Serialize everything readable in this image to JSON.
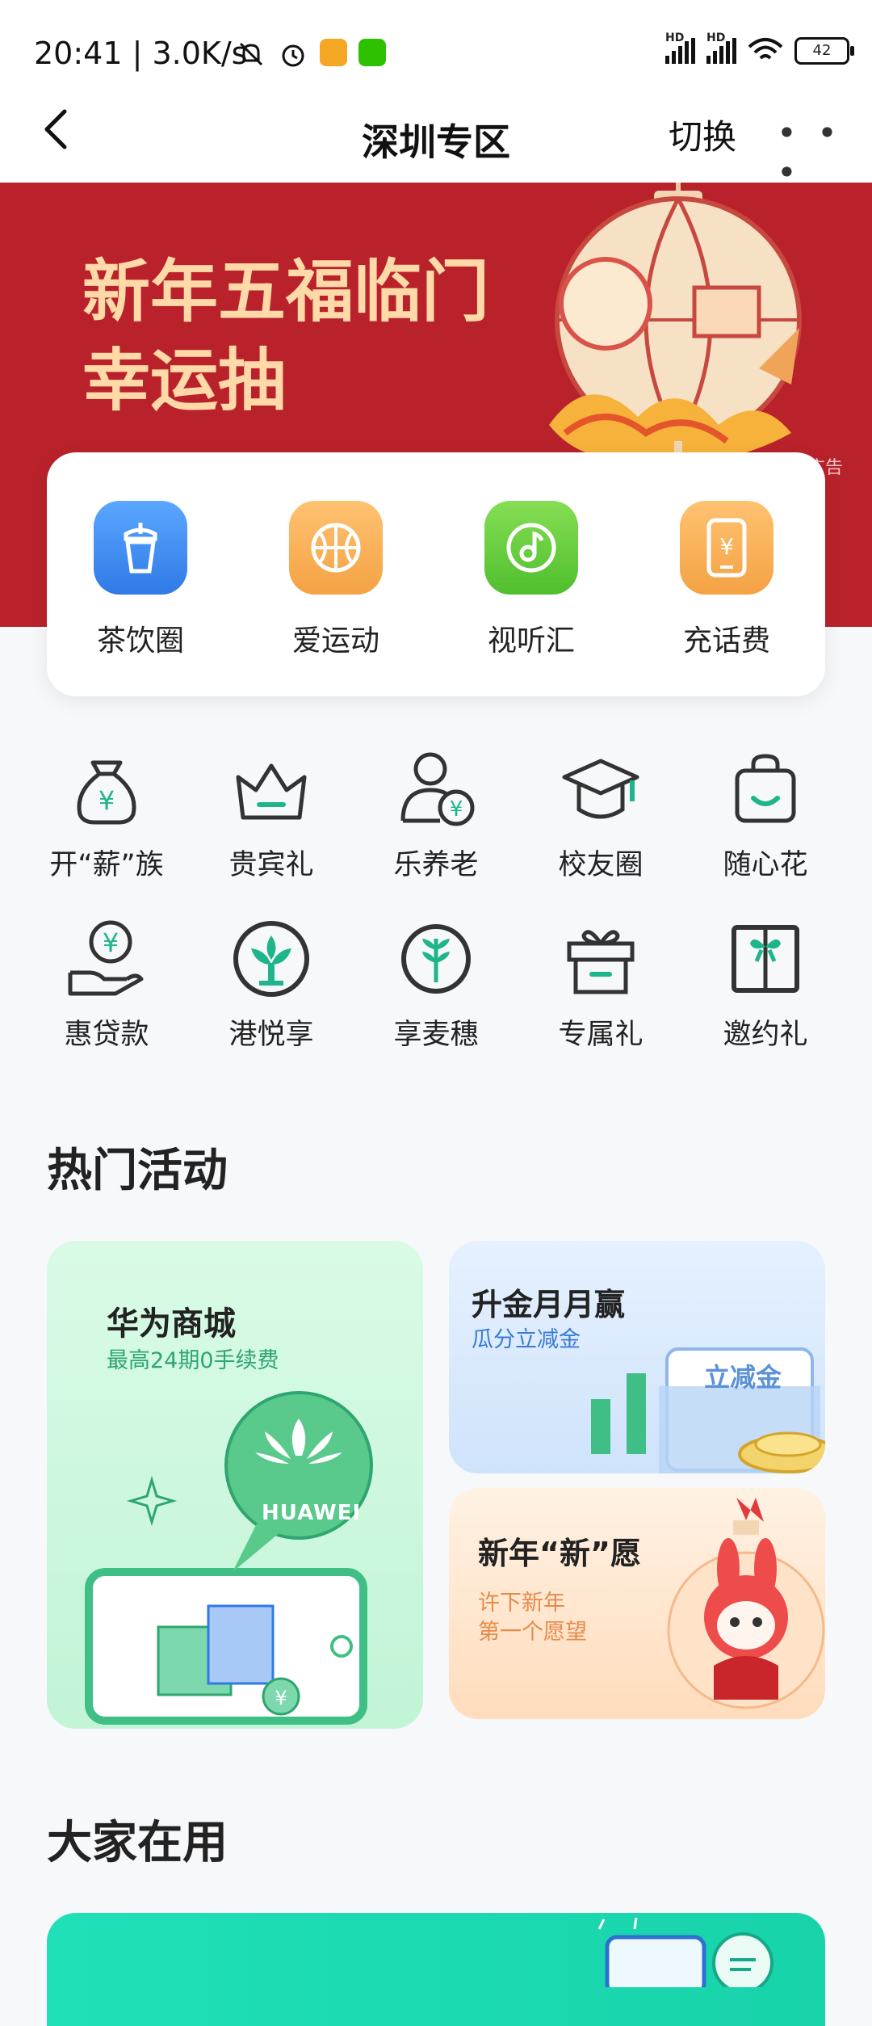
{
  "status_bar": {
    "time": "20:41",
    "speed": "3.0K/s",
    "network_labels": [
      "HD",
      "HD"
    ],
    "battery": "42"
  },
  "nav": {
    "title": "深圳专区",
    "switch_label": "切换"
  },
  "banner": {
    "title": "新年五福临门\n幸运抽",
    "ad_label": "广告",
    "bg_color": "#b9222b"
  },
  "quick_links": [
    {
      "label": "茶饮圈",
      "icon": "tea-cup-icon",
      "color": "#3b87f0"
    },
    {
      "label": "爱运动",
      "icon": "basketball-icon",
      "color": "#f4a244"
    },
    {
      "label": "视听汇",
      "icon": "music-icon",
      "color": "#5cc83e"
    },
    {
      "label": "充话费",
      "icon": "phone-bill-icon",
      "color": "#f4a244"
    }
  ],
  "services": [
    {
      "label": "开“薪”族",
      "icon": "money-bag-icon"
    },
    {
      "label": "贵宾礼",
      "icon": "crown-icon"
    },
    {
      "label": "乐养老",
      "icon": "person-yuan-icon"
    },
    {
      "label": "校友圈",
      "icon": "graduation-cap-icon"
    },
    {
      "label": "随心花",
      "icon": "shopping-bag-icon"
    },
    {
      "label": "惠贷款",
      "icon": "hand-yuan-icon"
    },
    {
      "label": "港悦享",
      "icon": "bauhinia-icon"
    },
    {
      "label": "享麦穗",
      "icon": "wheat-icon"
    },
    {
      "label": "专属礼",
      "icon": "gift-box-icon"
    },
    {
      "label": "邀约礼",
      "icon": "gift-card-icon"
    }
  ],
  "hot_activities": {
    "title": "热门活动",
    "huawei": {
      "title": "华为商城",
      "subtitle": "最高24期0手续费",
      "brand": "HUAWEI"
    },
    "gold": {
      "title": "升金月月赢",
      "subtitle": "瓜分立减金",
      "badge": "立减金"
    },
    "wish": {
      "title": "新年“新”愿",
      "subtitle_line1": "许下新年",
      "subtitle_line2": "第一个愿望"
    }
  },
  "popular": {
    "title": "大家在用"
  },
  "colors": {
    "accent_green": "#1fb58c",
    "icon_dark": "#333333"
  }
}
